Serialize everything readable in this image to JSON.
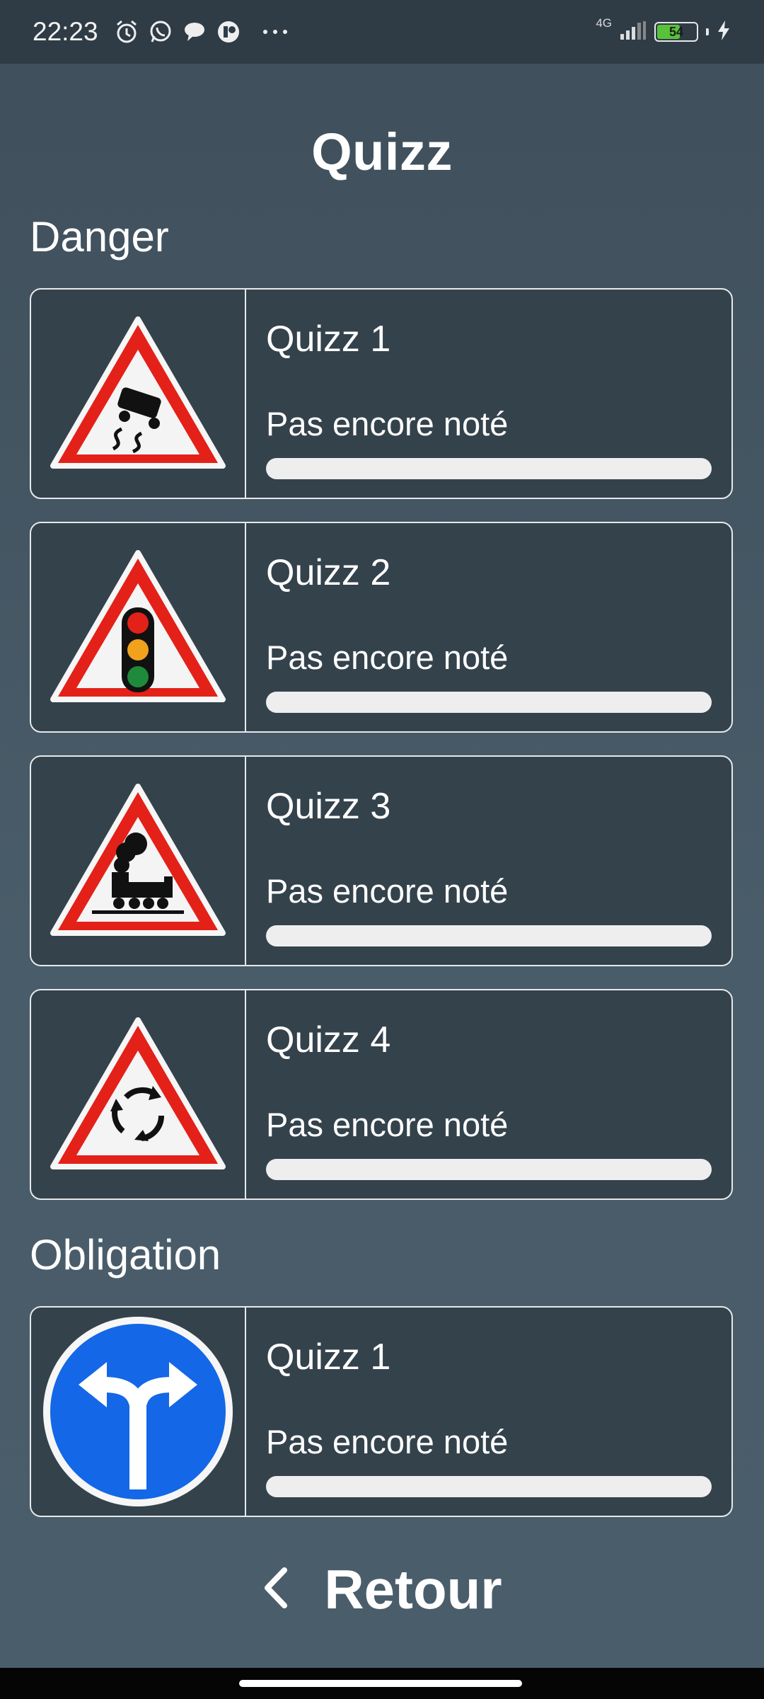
{
  "status_bar": {
    "time": "22:23",
    "network": "4G",
    "battery": "54",
    "icons": [
      "alarm-icon",
      "whatsapp-icon",
      "chat-icon",
      "app-icon",
      "more-icon"
    ]
  },
  "page_title": "Quizz",
  "sections": [
    {
      "title": "Danger",
      "items": [
        {
          "title": "Quizz 1",
          "status": "Pas encore noté",
          "progress": 0,
          "sign": "slippery-road-sign"
        },
        {
          "title": "Quizz 2",
          "status": "Pas encore noté",
          "progress": 0,
          "sign": "traffic-light-sign"
        },
        {
          "title": "Quizz 3",
          "status": "Pas encore noté",
          "progress": 0,
          "sign": "level-crossing-sign"
        },
        {
          "title": "Quizz 4",
          "status": "Pas encore noté",
          "progress": 0,
          "sign": "roundabout-sign"
        }
      ]
    },
    {
      "title": "Obligation",
      "items": [
        {
          "title": "Quizz 1",
          "status": "Pas encore noté",
          "progress": 0,
          "sign": "turn-left-or-right-sign"
        }
      ]
    }
  ],
  "back_button": {
    "label": "Retour",
    "icon": "chevron-left-icon"
  },
  "colors": {
    "background": "#455763",
    "card": "#34424c",
    "progress_track": "#eeeeee",
    "danger_red": "#e32119",
    "obligation_blue": "#1467e6"
  }
}
